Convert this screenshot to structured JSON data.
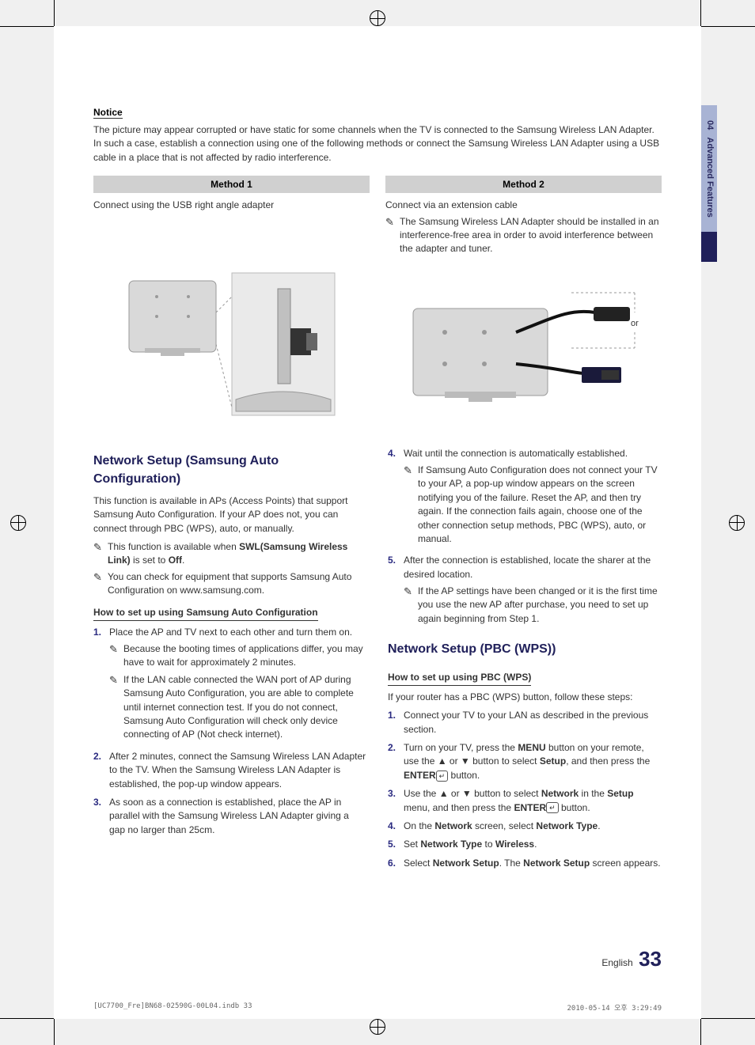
{
  "side_tab": {
    "num": "04",
    "label": "Advanced Features"
  },
  "notice": {
    "heading": "Notice",
    "para": "The picture may appear corrupted or have static for some channels when the TV is connected to the Samsung Wireless LAN Adapter. In such a case, establish a connection using one of the following methods or connect the Samsung Wireless LAN Adapter using a USB cable in a place that is not affected by radio interference."
  },
  "method1": {
    "header": "Method 1",
    "sub": "Connect using the USB right angle adapter"
  },
  "method2": {
    "header": "Method 2",
    "sub": "Connect via an extension cable",
    "note": "The Samsung Wireless LAN Adapter should be installed in an interference-free area in order to avoid interference between the adapter and tuner.",
    "or": "or"
  },
  "left": {
    "title": "Network Setup (Samsung Auto Configuration)",
    "para": "This function is available in APs (Access Points) that support Samsung Auto Configuration. If your AP does not, you can connect through PBC (WPS), auto, or manually.",
    "note_a_pre": "This function is available when ",
    "note_a_bold": "SWL(Samsung Wireless Link)",
    "note_a_post": " is set to ",
    "note_a_off": "Off",
    "note_b": "You can check for equipment that supports Samsung Auto Configuration on www.samsung.com.",
    "subhead": "How to set up using Samsung Auto Configuration",
    "steps": {
      "s1": "Place the AP and TV next to each other and turn them on.",
      "s1_note_a": "Because the booting times of applications differ, you may have to wait for approximately 2 minutes.",
      "s1_note_b": "If the LAN cable connected the WAN port of AP during Samsung Auto Configuration, you are able to complete until internet connection test. If you do not connect, Samsung Auto Configuration will check only device connecting of AP (Not check internet).",
      "s2": "After 2 minutes, connect the Samsung Wireless LAN Adapter to the TV. When the Samsung Wireless LAN Adapter is established, the pop-up window appears.",
      "s3": "As soon as a connection is established, place the AP in parallel with the Samsung Wireless LAN Adapter giving a gap no larger than 25cm."
    }
  },
  "right": {
    "s4": "Wait until the connection is automatically established.",
    "s4_note": "If Samsung Auto Configuration does not connect your TV to your AP, a pop-up window appears on the screen notifying you of the failure. Reset the AP, and then try again. If the connection fails again, choose one of the other connection setup methods, PBC (WPS), auto, or manual.",
    "s5": "After the connection is established, locate the sharer at the desired location.",
    "s5_note": "If the AP settings have been changed or it is the first time you use the new AP after purchase, you need to set up again beginning from Step 1.",
    "title2": "Network Setup (PBC (WPS))",
    "subhead2": "How to set up using PBC (WPS)",
    "intro2": "If your router has a PBC (WPS) button, follow these steps:",
    "p1": "Connect your TV to your LAN as described in the previous section.",
    "p2_a": "Turn on your TV, press the ",
    "p2_menu": "MENU",
    "p2_b": " button on your remote, use the ▲ or ▼ button to select ",
    "p2_setup": "Setup",
    "p2_c": ", and then press the ",
    "p2_enter": "ENTER",
    "p2_d": " button.",
    "p3_a": "Use the ▲ or ▼ button to select ",
    "p3_net": "Network",
    "p3_b": " in the ",
    "p3_setup": "Setup",
    "p3_c": " menu, and then press the ",
    "p3_enter": "ENTER",
    "p3_d": " button.",
    "p4_a": "On the ",
    "p4_net": "Network",
    "p4_b": " screen, select ",
    "p4_ntype": "Network Type",
    "p5_a": "Set ",
    "p5_ntype": "Network Type",
    "p5_b": " to ",
    "p5_wl": "Wireless",
    "p6_a": "Select ",
    "p6_ns": "Network Setup",
    "p6_b": ". The ",
    "p6_ns2": "Network Setup",
    "p6_c": " screen appears."
  },
  "page_num": {
    "lang": "English",
    "num": "33"
  },
  "footer": {
    "left": "[UC7700_Fre]BN68-02590G-00L04.indb   33",
    "right": "2010-05-14   오후 3:29:49"
  }
}
